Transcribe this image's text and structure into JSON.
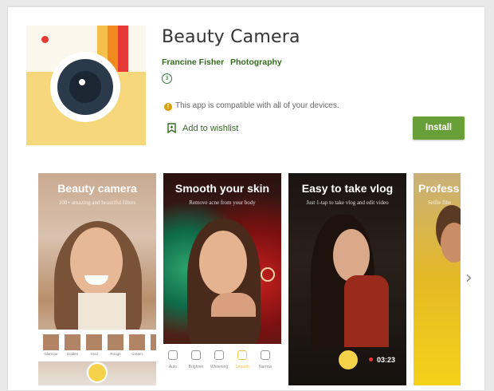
{
  "app": {
    "title": "Beauty Camera",
    "developer": "Francine Fisher",
    "category": "Photography",
    "content_rating": "3",
    "compatibility": "This app is compatible with all of your devices.",
    "wishlist_label": "Add to wishlist",
    "install_label": "Install",
    "icon_stripe_colors": [
      "#f6c14a",
      "#f08a1f",
      "#e53935"
    ]
  },
  "screenshots": [
    {
      "title": "Beauty camera",
      "subtitle": "100+ amazing and beautiful filters",
      "thumbnails": [
        "Glamour",
        "Golden",
        "Yard",
        "Rouge",
        "Cream",
        "Blush"
      ]
    },
    {
      "title": "Smooth your skin",
      "subtitle": "Remove acne from your body",
      "tools": [
        "Auto",
        "Brighten",
        "Whitening",
        "Smooth",
        "Narrow"
      ]
    },
    {
      "title": "Easy to take vlog",
      "subtitle": "Just 1-tap to take vlog and edit video",
      "timer": "03:23"
    },
    {
      "title": "Profess",
      "subtitle": "Selfie filte"
    }
  ],
  "nav": {
    "next_icon": "chevron-right-icon"
  }
}
